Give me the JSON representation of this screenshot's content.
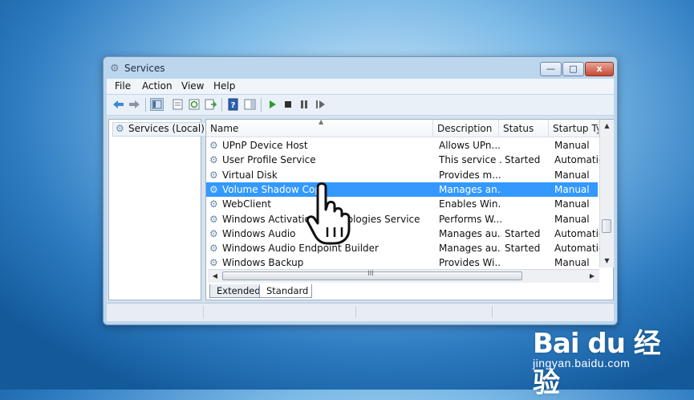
{
  "window": {
    "title": "Services",
    "controls": {
      "minimize": "—",
      "maximize": "□",
      "close": "x"
    }
  },
  "menu": [
    "File",
    "Action",
    "View",
    "Help"
  ],
  "toolbar": [
    {
      "icon": "back-arrow-icon"
    },
    {
      "icon": "forward-arrow-icon"
    },
    {
      "icon": "show-hide-console-tree-icon"
    },
    {
      "icon": "properties-icon"
    },
    {
      "icon": "refresh-icon"
    },
    {
      "icon": "export-list-icon"
    },
    {
      "icon": "help-icon"
    },
    {
      "icon": "action-pane-icon"
    },
    {
      "icon": "start-service-icon"
    },
    {
      "icon": "stop-service-icon"
    },
    {
      "icon": "pause-service-icon"
    },
    {
      "icon": "restart-service-icon"
    }
  ],
  "tree": {
    "root_label": "Services (Local)"
  },
  "table": {
    "columns": [
      "Name",
      "Description",
      "Status",
      "Startup Typ"
    ],
    "rows": [
      {
        "name": "UPnP Device Host",
        "description": "Allows UPn...",
        "status": "",
        "startup": "Manual",
        "selected": false
      },
      {
        "name": "User Profile Service",
        "description": "This service ...",
        "status": "Started",
        "startup": "Automatic",
        "selected": false
      },
      {
        "name": "Virtual Disk",
        "description": "Provides m...",
        "status": "",
        "startup": "Manual",
        "selected": false
      },
      {
        "name": "Volume Shadow Copy",
        "description": "Manages an...",
        "status": "",
        "startup": "Manual",
        "selected": true
      },
      {
        "name": "WebClient",
        "description": "Enables Win...",
        "status": "",
        "startup": "Manual",
        "selected": false
      },
      {
        "name": "Windows Activation Technologies Service",
        "description": "Performs W...",
        "status": "",
        "startup": "Manual",
        "selected": false
      },
      {
        "name": "Windows Audio",
        "description": "Manages au...",
        "status": "Started",
        "startup": "Automatic",
        "selected": false
      },
      {
        "name": "Windows Audio Endpoint Builder",
        "description": "Manages au...",
        "status": "Started",
        "startup": "Automatic",
        "selected": false
      },
      {
        "name": "Windows Backup",
        "description": "Provides Wi...",
        "status": "",
        "startup": "Manual",
        "selected": false
      }
    ],
    "hscroll_grip": "III"
  },
  "tabs": [
    {
      "label": "Extended",
      "active": false
    },
    {
      "label": "Standard",
      "active": true
    }
  ],
  "watermark": {
    "logo": "Bai du 经验",
    "site": "jingyan.baidu.com"
  }
}
